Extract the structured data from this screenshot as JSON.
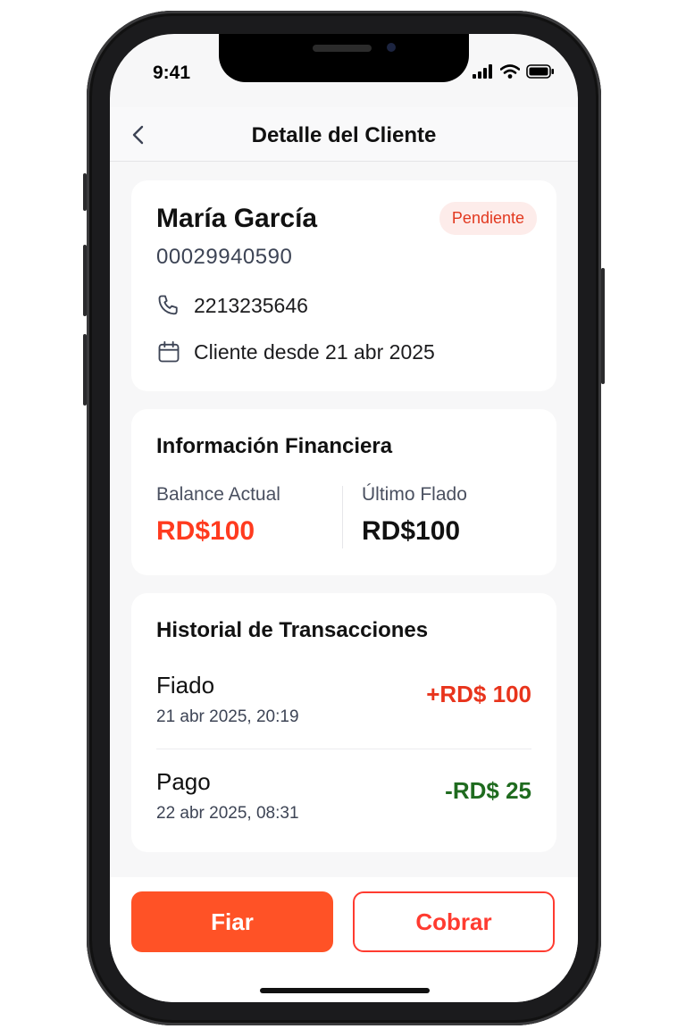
{
  "status_bar": {
    "time": "9:41"
  },
  "navbar": {
    "title": "Detalle del Cliente"
  },
  "client": {
    "name": "María García",
    "status_badge": "Pendiente",
    "id_number": "00029940590",
    "phone": "2213235646",
    "since": "Cliente desde 21 abr 2025"
  },
  "financial": {
    "title": "Información Financiera",
    "balance_label": "Balance Actual",
    "balance_value": "RD$100",
    "last_credit_label": "Último Flado",
    "last_credit_value": "RD$100"
  },
  "history": {
    "title": "Historial de Transacciones",
    "items": [
      {
        "type": "Fiado",
        "date": "21 abr 2025, 20:19",
        "amount": "+RD$ 100",
        "color": "#e8341c"
      },
      {
        "type": "Pago",
        "date": "22 abr 2025, 08:31",
        "amount": "-RD$ 25",
        "color": "#1f6b1f"
      }
    ]
  },
  "actions": {
    "fiar_label": "Fiar",
    "cobrar_label": "Cobrar"
  },
  "colors": {
    "accent": "#ff5226",
    "danger": "#e8341c",
    "success": "#1f6b1f",
    "badge_bg": "#fdecea"
  },
  "icons": [
    "back-chevron-icon",
    "phone-icon",
    "calendar-icon",
    "signal-icon",
    "wifi-icon",
    "battery-icon"
  ]
}
